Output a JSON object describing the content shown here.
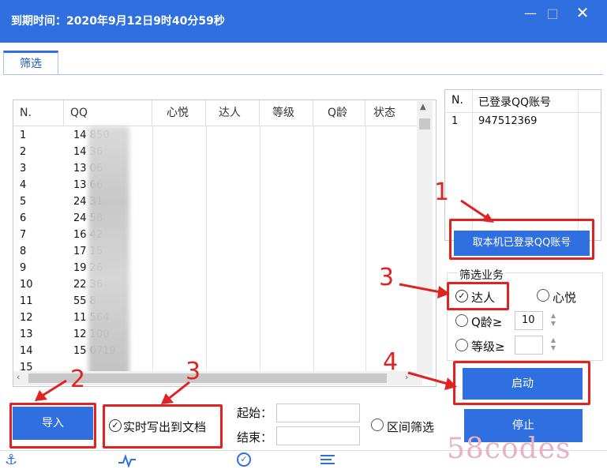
{
  "window": {
    "title": "到期时间：2020年9月12日9时40分59秒",
    "minimize_icon": "—",
    "maximize_icon": "□",
    "close_icon": "✕"
  },
  "tabs": [
    {
      "label": "筛选"
    }
  ],
  "table": {
    "columns": [
      "N.",
      "QQ",
      "心悦",
      "达人",
      "等级",
      "Q龄",
      "状态"
    ],
    "rows": [
      {
        "n": "1",
        "qq": "14      850"
      },
      {
        "n": "2",
        "qq": "14      36"
      },
      {
        "n": "3",
        "qq": "13      06"
      },
      {
        "n": "4",
        "qq": "13      66"
      },
      {
        "n": "5",
        "qq": "24      31"
      },
      {
        "n": "6",
        "qq": "24      58"
      },
      {
        "n": "7",
        "qq": "16      42"
      },
      {
        "n": "8",
        "qq": "17      15"
      },
      {
        "n": "9",
        "qq": "19      26"
      },
      {
        "n": "10",
        "qq": "22      36"
      },
      {
        "n": "11",
        "qq": "55      8"
      },
      {
        "n": "12",
        "qq": "11      564"
      },
      {
        "n": "13",
        "qq": "12      100"
      },
      {
        "n": "14",
        "qq": "15      0719"
      },
      {
        "n": "15",
        "qq": ""
      }
    ]
  },
  "logged_in_list": {
    "columns": [
      "N.",
      "已登录QQ账号"
    ],
    "rows": [
      {
        "n": "1",
        "qq": "947512369"
      }
    ]
  },
  "buttons": {
    "get_logged_in": "取本机已登录QQ账号",
    "import": "导入",
    "start": "启动",
    "stop": "停止"
  },
  "filter_group": {
    "title": "筛选业务",
    "daren_label": "达人",
    "xinyue_label": "心悦",
    "qage_label": "Q龄≥",
    "qage_value": "10",
    "level_label": "等级≥",
    "level_value": ""
  },
  "export_option": {
    "label": "实时写出到文档",
    "checked": true
  },
  "range": {
    "start_label": "起始：",
    "end_label": "结束：",
    "range_filter_label": "区间筛选"
  },
  "annotations": {
    "n1": "1",
    "n2": "2",
    "n3a": "3",
    "n3b": "3",
    "n4": "4"
  },
  "watermark": "58codes",
  "colors": {
    "accent": "#2f6fe0",
    "annotation": "#e02222"
  },
  "status_icons": [
    "anchor-icon",
    "pulse-icon",
    "check-circle-icon",
    "list-icon"
  ]
}
